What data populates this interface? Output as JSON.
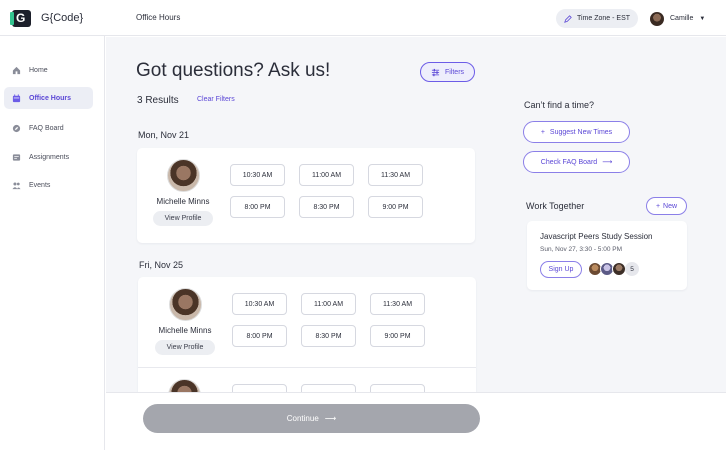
{
  "brand": {
    "logo_glyph": "G",
    "name": "G{Code}"
  },
  "header": {
    "breadcrumb": "Office Hours",
    "timezone": "Time Zone - EST",
    "user_name": "Camille"
  },
  "sidebar": {
    "items": [
      {
        "label": "Home",
        "icon": "home-icon"
      },
      {
        "label": "Office Hours",
        "icon": "calendar-icon",
        "active": true
      },
      {
        "label": "FAQ Board",
        "icon": "compass-icon"
      },
      {
        "label": "Assignments",
        "icon": "assignment-icon"
      },
      {
        "label": "Events",
        "icon": "people-icon"
      }
    ]
  },
  "page": {
    "title": "Got questions? Ask us!",
    "filters_label": "Filters",
    "results": "3 Results",
    "clear_filters": "Clear Filters"
  },
  "days": [
    {
      "date": "Mon, Nov 21",
      "mentor": "Michelle Minns",
      "view_profile": "View Profile",
      "slots": [
        "10:30 AM",
        "11:00 AM",
        "11:30 AM",
        "8:00 PM",
        "8:30 PM",
        "9:00 PM"
      ]
    },
    {
      "date": "Fri, Nov 25",
      "mentor": "Michelle Minns",
      "view_profile": "View Profile",
      "slots": [
        "10:30 AM",
        "11:00 AM",
        "11:30 AM",
        "8:00 PM",
        "8:30 PM",
        "9:00 PM"
      ]
    }
  ],
  "right": {
    "cant_find": "Can’t find a time?",
    "suggest_label": "Suggest New Times",
    "faq_label": "Check FAQ Board",
    "work_together": "Work Together",
    "new_label": "New",
    "session": {
      "title": "Javascript Peers Study Session",
      "time": "Sun, Nov 27, 3:30 - 5:00 PM",
      "signup": "Sign Up",
      "extra_count": "5"
    }
  },
  "footer": {
    "continue_label": "Continue"
  },
  "colors": {
    "accent": "#5b47d6",
    "accent_border": "#8b7fe8",
    "brand_green": "#34c38f",
    "continue_disabled": "#a4a6ad"
  }
}
